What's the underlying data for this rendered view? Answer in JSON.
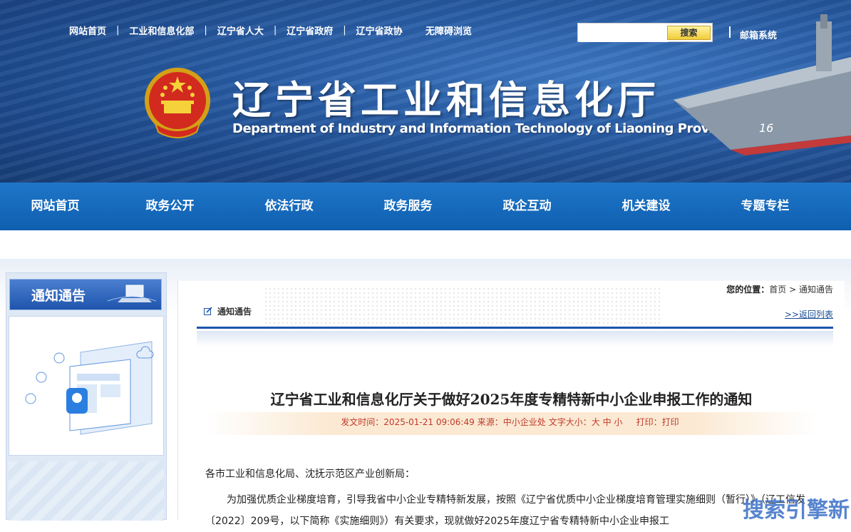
{
  "top_links": [
    "网站首页",
    "工业和信息化部",
    "辽宁省人大",
    "辽宁省政府",
    "辽宁省政协",
    "无障碍浏览"
  ],
  "search": {
    "button_label": "搜索",
    "placeholder": ""
  },
  "mail_label": "邮箱系统",
  "site_title_cn": "辽宁省工业和信息化厅",
  "site_title_en": "Department of Industry and Information Technology of Liaoning Province",
  "nav": [
    "网站首页",
    "政务公开",
    "依法行政",
    "政务服务",
    "政企互动",
    "机关建设",
    "专题专栏"
  ],
  "sidebar": {
    "title": "通知通告"
  },
  "location": {
    "label": "您的位置：",
    "home": "首页",
    "sep": ">",
    "current": "通知通告"
  },
  "section_label": "通知通告",
  "back_label": ">>返回列表",
  "article": {
    "title": "辽宁省工业和信息化厅关于做好2025年度专精特新中小企业申报工作的通知",
    "meta_time": "发文时间：2025-01-21 09:06:49",
    "meta_source": "来源：中小企业处",
    "meta_font": "文字大小：大 中 小",
    "meta_print": "打印：打印",
    "para1": "各市工业和信息化局、沈抚示范区产业创新局：",
    "para2": "为加强优质企业梯度培育，引导我省中小企业专精特新发展，按照《辽宁省优质中小企业梯度培育管理实施细则（暂行）》（辽工信发〔2022〕209号，以下简称《实施细则》）有关要求，现就做好2025年度辽宁省专精特新中小企业申报工"
  },
  "watermark": "搜索引擎新",
  "colors": {
    "nav_bg": "#1565b8",
    "accent_blue": "#1e55ac",
    "meta_red": "#c0392b",
    "search_btn": "#f2cc3a"
  }
}
